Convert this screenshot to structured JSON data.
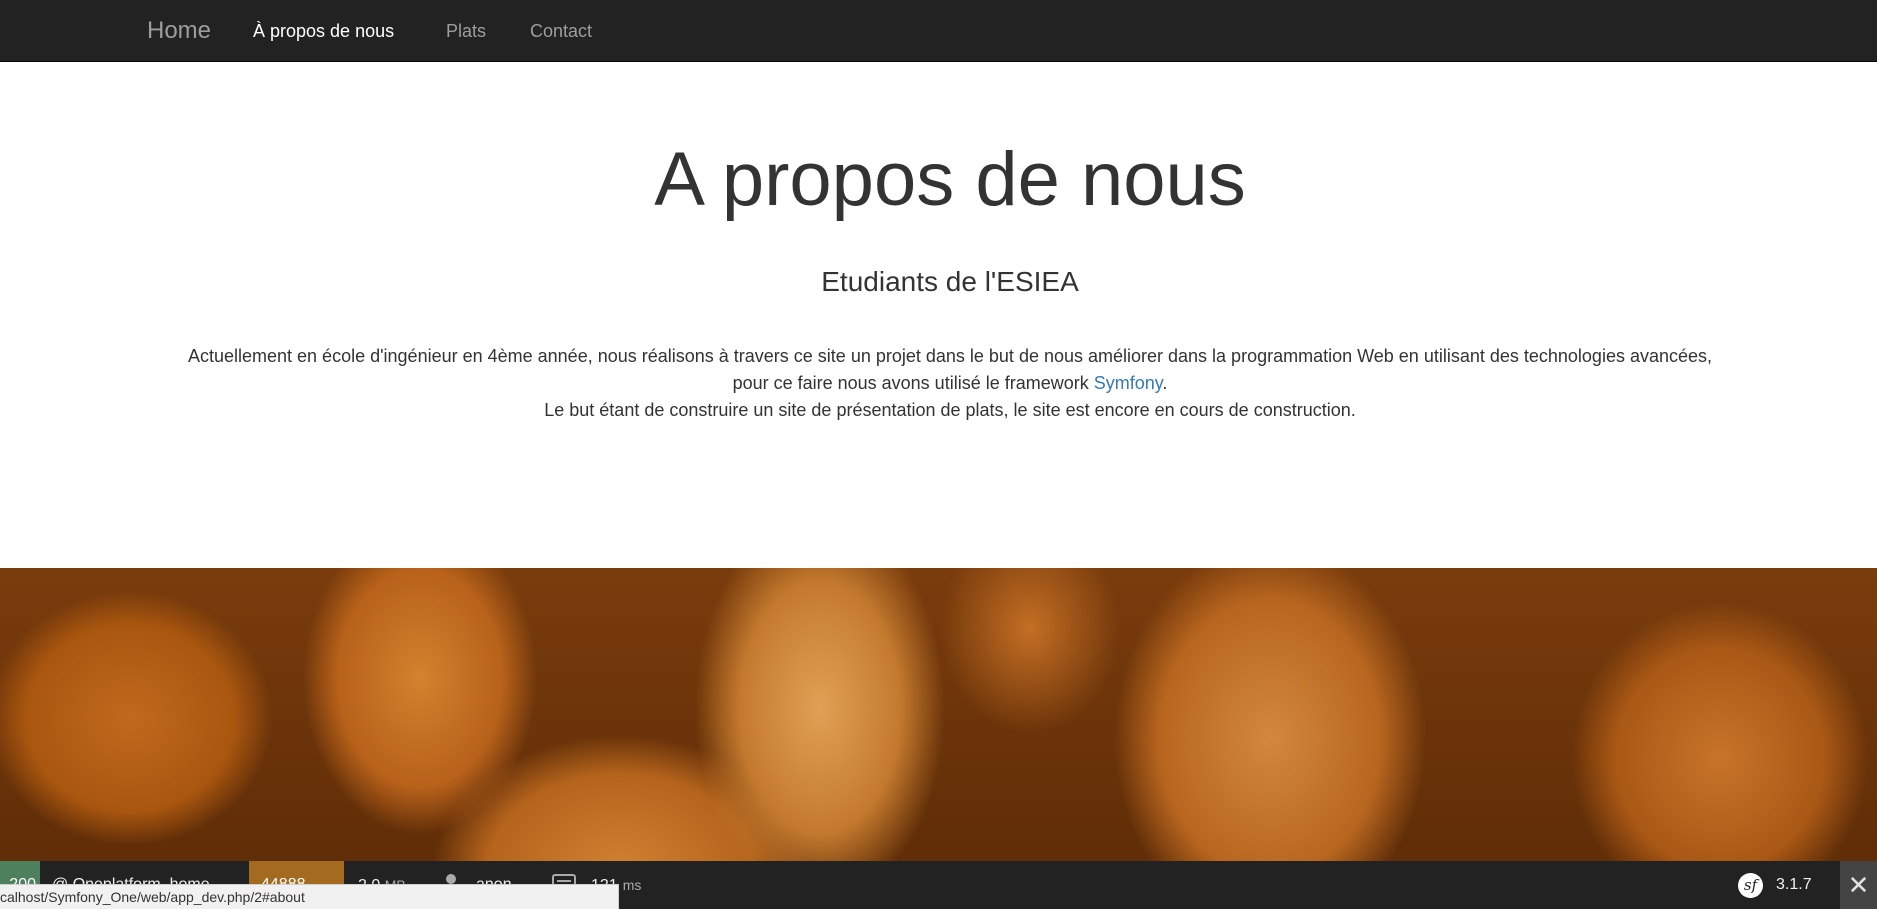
{
  "nav": {
    "brand": "Home",
    "items": [
      {
        "label": "À propos de nous",
        "active": true
      },
      {
        "label": "Plats",
        "active": false
      },
      {
        "label": "Contact",
        "active": false
      }
    ]
  },
  "intro": {
    "title": "A propos de nous",
    "subtitle": "Etudiants de l'ESIEA",
    "paragraph_before_link": "Actuellement en école d'ingénieur en 4ème année, nous réalisons à travers ce site un projet dans le but de nous améliorer dans la programmation Web en utilisant des technologies avancées, pour ce faire nous avons utilisé le framework ",
    "link_text": "Symfony",
    "paragraph_after_link": ".",
    "paragraph_line2": "Le but étant de construire un site de présentation de plats, le site est encore en cours de construction."
  },
  "toolbar": {
    "status_code": "200",
    "route": "@ Oneplatform_home",
    "token": "44888",
    "memory_value": "2.0",
    "memory_unit": "MB",
    "user": "anon.",
    "time_value": "121",
    "time_unit": "ms",
    "version": "3.1.7",
    "close_symbol": "✕"
  },
  "status_bar": {
    "url": "calhost/Symfony_One/web/app_dev.php/2#about"
  },
  "colors": {
    "navbar_bg": "#222222",
    "link": "#337ab7",
    "toolbar_status": "#4f805d",
    "toolbar_token": "#a46a1f"
  }
}
